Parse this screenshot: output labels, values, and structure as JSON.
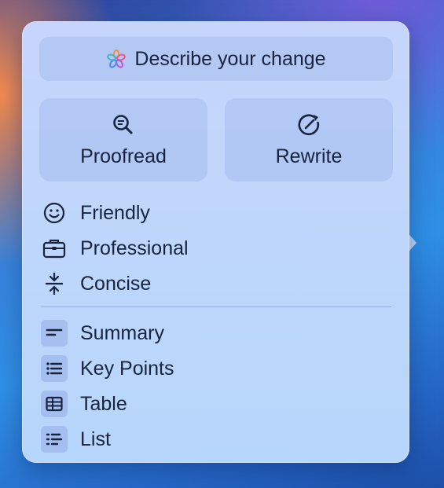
{
  "describe": {
    "label": "Describe your change",
    "icon": "apple-intelligence-icon"
  },
  "primary_actions": [
    {
      "label": "Proofread",
      "icon": "magnifier-check-icon"
    },
    {
      "label": "Rewrite",
      "icon": "rewrite-icon"
    }
  ],
  "tone_items": [
    {
      "label": "Friendly",
      "icon": "smiley-icon"
    },
    {
      "label": "Professional",
      "icon": "briefcase-icon"
    },
    {
      "label": "Concise",
      "icon": "compress-icon"
    }
  ],
  "format_items": [
    {
      "label": "Summary",
      "icon": "summary-icon"
    },
    {
      "label": "Key Points",
      "icon": "bulleted-list-icon"
    },
    {
      "label": "Table",
      "icon": "table-icon"
    },
    {
      "label": "List",
      "icon": "list-icon"
    }
  ],
  "colors": {
    "text": "#17233f",
    "panel": "#bfd6fb",
    "button": "#a6beee"
  }
}
